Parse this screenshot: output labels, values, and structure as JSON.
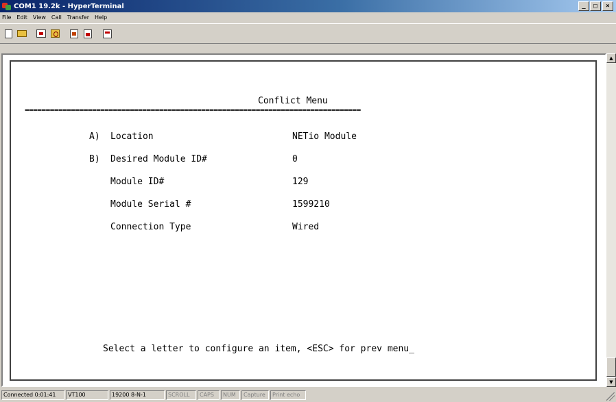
{
  "window": {
    "title": "COM1 19.2k - HyperTerminal",
    "controls": {
      "minimize": "_",
      "maximize": "□",
      "close": "×"
    }
  },
  "menu": [
    "File",
    "Edit",
    "View",
    "Call",
    "Transfer",
    "Help"
  ],
  "toolbar": {
    "icons": [
      "new-icon",
      "open-icon",
      "connect-icon",
      "disconnect-icon",
      "send-icon",
      "receive-icon",
      "properties-icon"
    ]
  },
  "terminal": {
    "title": "Conflict Menu",
    "separator": "================================================================================",
    "items": [
      {
        "key": "A)",
        "label": "Location",
        "value": "NETio Module"
      },
      {
        "key": "B)",
        "label": "Desired Module ID#",
        "value": "0"
      },
      {
        "key": "",
        "label": "Module ID#",
        "value": "129"
      },
      {
        "key": "",
        "label": "Module Serial #",
        "value": "1599210"
      },
      {
        "key": "",
        "label": "Connection Type",
        "value": "Wired"
      }
    ],
    "prompt": "Select a letter to configure an item, <ESC> for prev menu_"
  },
  "status": {
    "connected": "Connected 0:01:41",
    "emulation": "VT100",
    "settings": "19200 8-N-1",
    "scroll": "SCROLL",
    "caps": "CAPS",
    "num": "NUM",
    "capture": "Capture",
    "print_echo": "Print echo"
  },
  "scrollbar": {
    "up": "▲",
    "down": "▼"
  }
}
